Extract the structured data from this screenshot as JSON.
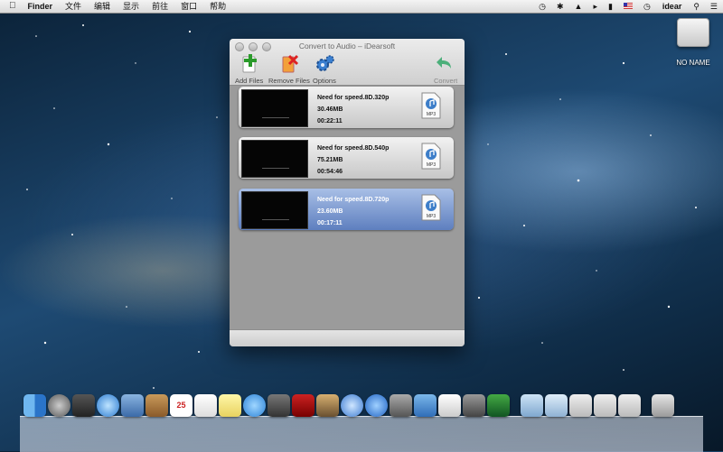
{
  "menubar": {
    "apple_icon": "apple-icon",
    "app_name": "Finder",
    "menus": [
      "文件",
      "编辑",
      "显示",
      "前往",
      "窗口",
      "帮助"
    ],
    "username": "idear",
    "status_icons": [
      "time-machine-icon",
      "bluetooth-icon",
      "wifi-icon",
      "volume-icon",
      "battery-icon",
      "flag-icon",
      "clock-icon",
      "spotlight-icon",
      "list-icon"
    ]
  },
  "desktop": {
    "drive_label": "NO NAME"
  },
  "window": {
    "title": "Convert to Audio – iDearsoft",
    "toolbar": {
      "add_files": "Add Files",
      "remove_files": "Remove Files",
      "options": "Options",
      "convert": "Convert"
    },
    "files": [
      {
        "name": "Need for speed.8D.320p",
        "size": "30.46MB",
        "duration": "00:22:11",
        "format": "MP3",
        "selected": false
      },
      {
        "name": "Need for speed.8D.540p",
        "size": "75.21MB",
        "duration": "00:54:46",
        "format": "MP3",
        "selected": false
      },
      {
        "name": "Need for speed.8D.720p",
        "size": "23.60MB",
        "duration": "00:17:11",
        "format": "MP3",
        "selected": true
      }
    ]
  },
  "dock": {
    "calendar_day": "25",
    "icons": [
      "finder-icon",
      "launchpad-icon",
      "mission-control-icon",
      "safari-icon",
      "preview-icon",
      "contacts-icon",
      "calendar-icon",
      "reminders-icon",
      "notes-icon",
      "messages-icon",
      "facetime-icon",
      "photo-booth-icon",
      "iphoto-icon",
      "itunes-icon",
      "app-store-icon",
      "system-preferences-icon",
      "xcode-icon",
      "textedit-icon",
      "keychain-icon",
      "music-icon",
      "documents-folder-icon",
      "downloads-folder-icon",
      "stack-icon",
      "stack-icon",
      "stack-icon",
      "trash-icon"
    ]
  }
}
